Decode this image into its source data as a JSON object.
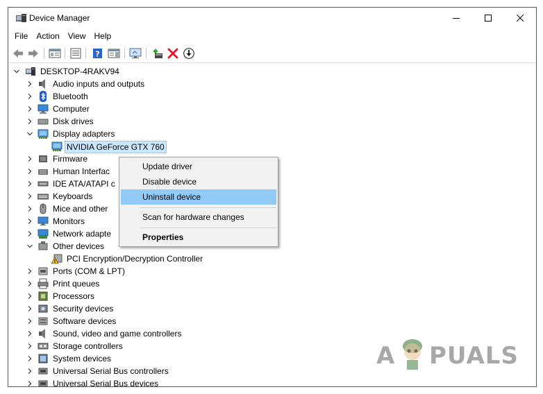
{
  "window": {
    "title": "Device Manager",
    "controls": [
      "minimize",
      "maximize",
      "close"
    ]
  },
  "menu": [
    "File",
    "Action",
    "View",
    "Help"
  ],
  "toolbar": {
    "buttons": [
      "back-arrow-icon",
      "forward-arrow-icon",
      "show-hide-console-tree-icon",
      "properties-icon",
      "help-icon",
      "action-pane-icon",
      "monitor-icon",
      "update-driver-icon",
      "uninstall-icon",
      "scan-hardware-icon"
    ]
  },
  "tree": {
    "root": "DESKTOP-4RAKV94",
    "items": [
      {
        "label": "Audio inputs and outputs",
        "expanded": false,
        "icon": "speaker-icon"
      },
      {
        "label": "Bluetooth",
        "expanded": false,
        "icon": "bluetooth-icon"
      },
      {
        "label": "Computer",
        "expanded": false,
        "icon": "computer-icon"
      },
      {
        "label": "Disk drives",
        "expanded": false,
        "icon": "disk-drive-icon"
      },
      {
        "label": "Display adapters",
        "expanded": true,
        "icon": "display-adapter-icon"
      },
      {
        "label": "NVIDIA GeForce GTX 760",
        "child": true,
        "selected": true,
        "icon": "display-adapter-icon"
      },
      {
        "label": "Firmware",
        "expanded": false,
        "icon": "firmware-icon"
      },
      {
        "label": "Human Interfac",
        "expanded": false,
        "icon": "hid-icon"
      },
      {
        "label": "IDE ATA/ATAPI c",
        "expanded": false,
        "icon": "ide-icon"
      },
      {
        "label": "Keyboards",
        "expanded": false,
        "icon": "keyboard-icon"
      },
      {
        "label": "Mice and other",
        "expanded": false,
        "icon": "mouse-icon"
      },
      {
        "label": "Monitors",
        "expanded": false,
        "icon": "monitor-icon"
      },
      {
        "label": "Network adapte",
        "expanded": false,
        "icon": "network-adapter-icon"
      },
      {
        "label": "Other devices",
        "expanded": true,
        "icon": "other-devices-icon"
      },
      {
        "label": "PCI Encryption/Decryption Controller",
        "child": true,
        "icon": "warning-device-icon"
      },
      {
        "label": "Ports (COM & LPT)",
        "expanded": false,
        "icon": "port-icon"
      },
      {
        "label": "Print queues",
        "expanded": false,
        "icon": "printer-icon"
      },
      {
        "label": "Processors",
        "expanded": false,
        "icon": "processor-icon"
      },
      {
        "label": "Security devices",
        "expanded": false,
        "icon": "security-device-icon"
      },
      {
        "label": "Software devices",
        "expanded": false,
        "icon": "software-device-icon"
      },
      {
        "label": "Sound, video and game controllers",
        "expanded": false,
        "icon": "speaker-icon"
      },
      {
        "label": "Storage controllers",
        "expanded": false,
        "icon": "storage-controller-icon"
      },
      {
        "label": "System devices",
        "expanded": false,
        "icon": "system-device-icon"
      },
      {
        "label": "Universal Serial Bus controllers",
        "expanded": false,
        "icon": "usb-icon"
      },
      {
        "label": "Universal Serial Bus devices",
        "expanded": false,
        "icon": "usb-icon"
      }
    ]
  },
  "context_menu": {
    "items": [
      {
        "label": "Update driver"
      },
      {
        "label": "Disable device"
      },
      {
        "label": "Uninstall device",
        "highlighted": true
      },
      {
        "label": "Scan for hardware changes"
      },
      {
        "label": "Properties",
        "bold": true
      }
    ]
  },
  "watermark": {
    "text_a": "A",
    "text_rest": "PUALS"
  },
  "colors": {
    "selection": "#cce8ff",
    "menu_highlight": "#91c9f7",
    "uninstall_red": "#e81123",
    "update_green": "#2aa12a"
  }
}
